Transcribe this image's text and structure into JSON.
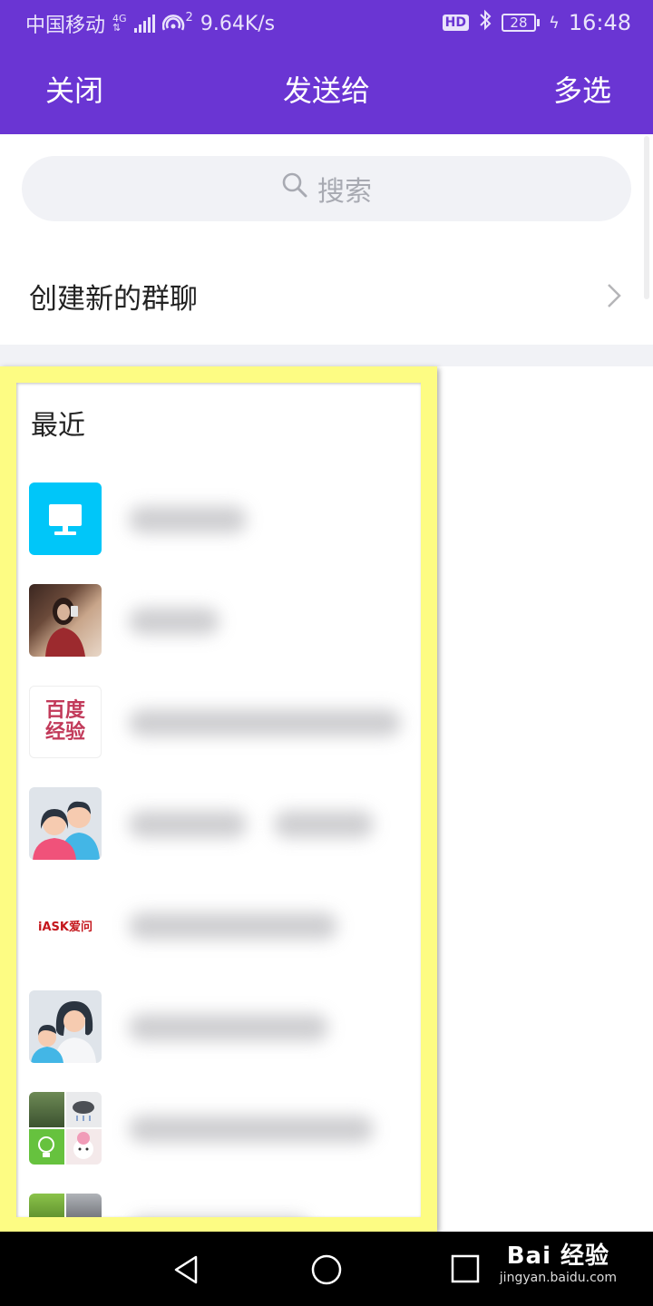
{
  "status_bar": {
    "carrier": "中国移动",
    "net_tag": "4G",
    "hotspot_sub": "2",
    "speed": "9.64K/s",
    "hd": "HD",
    "battery": "28",
    "time": "16:48"
  },
  "header": {
    "close_label": "关闭",
    "title": "发送给",
    "multi_select_label": "多选"
  },
  "search": {
    "placeholder": "搜索"
  },
  "create_group": {
    "label": "创建新的群聊"
  },
  "recent": {
    "title": "最近",
    "contacts": [
      {
        "avatar": "monitor-icon",
        "color": "#00c6f9"
      },
      {
        "avatar": "photo-avatar"
      },
      {
        "avatar": "baidu-jingyan-logo",
        "logo_text": "百度经验"
      },
      {
        "avatar": "couple-avatar"
      },
      {
        "avatar": "iask-logo",
        "logo_text": "iASK爱问"
      },
      {
        "avatar": "mother-child-avatar"
      },
      {
        "avatar": "group-collage-avatar"
      },
      {
        "avatar": "group-collage-avatar"
      }
    ]
  },
  "watermark": {
    "main": "Bai 经验",
    "sub": "jingyan.baidu.com"
  },
  "colors": {
    "header_bg": "#6a35d3",
    "highlight": "#fdfc83"
  }
}
